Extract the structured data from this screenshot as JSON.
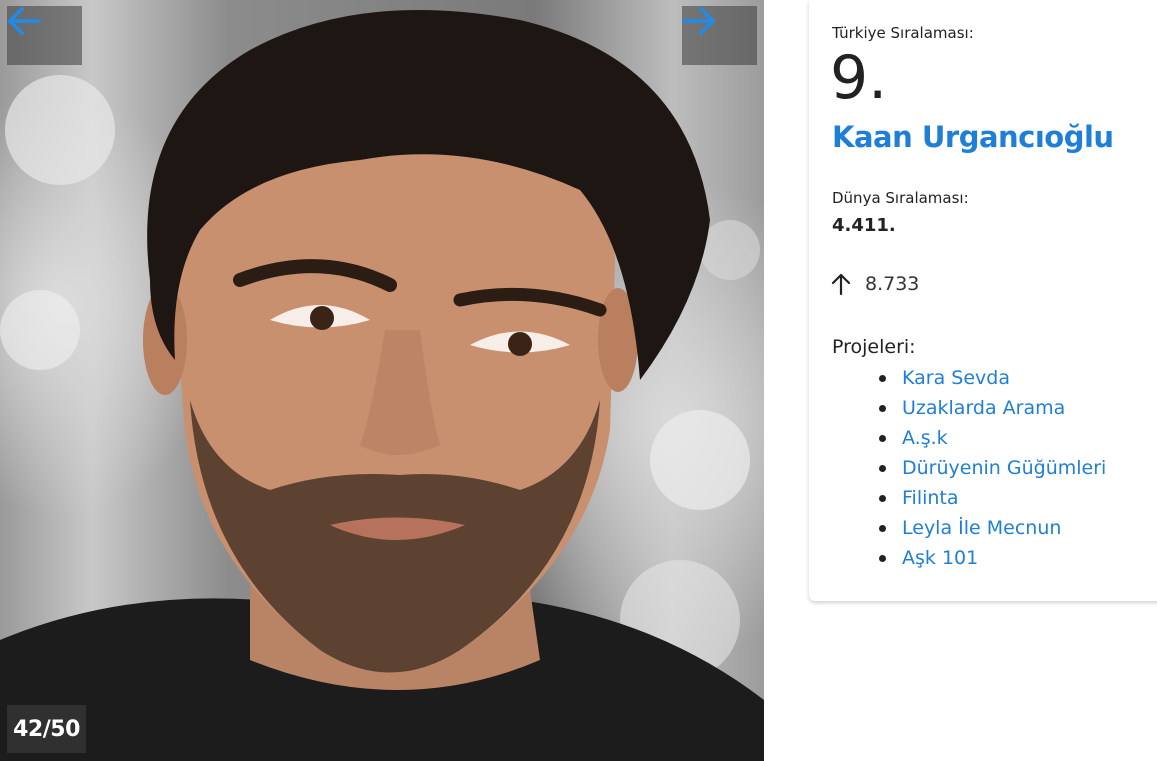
{
  "gallery": {
    "counter": "42/50",
    "prev_icon": "arrow-left-icon",
    "next_icon": "arrow-right-icon",
    "arrow_color": "#1f8ceb"
  },
  "profile": {
    "turkey_rank_label": "Türkiye Sıralaması:",
    "turkey_rank": "9.",
    "name": "Kaan Urgancıoğlu",
    "world_rank_label": "Dünya Sıralaması:",
    "world_rank": "4.411.",
    "trend_icon": "arrow-up-icon",
    "trend_value": "8.733",
    "projects_label": "Projeleri:",
    "projects": [
      "Kara Sevda",
      "Uzaklarda Arama",
      "A.ş.k",
      "Dürüyenin Güğümleri",
      "Filinta",
      "Leyla İle Mecnun",
      "Aşk 101"
    ]
  },
  "colors": {
    "link": "#1f7fd6",
    "text": "#222222"
  }
}
